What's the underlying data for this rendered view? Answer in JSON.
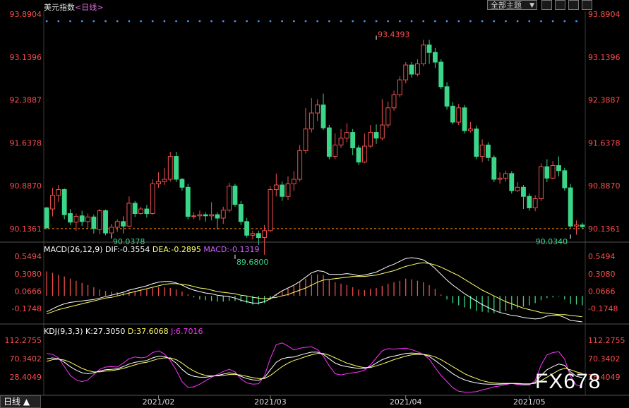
{
  "header": {
    "instrument": "美元指数",
    "timeframe": "<日线>",
    "theme_select": "全部主题"
  },
  "colors": {
    "up": "#f05050",
    "down": "#3cd68a",
    "axis_red": "#ff4d4d",
    "last_line": "#ff8c00",
    "dif": "#ffffff",
    "dea": "#ffff66",
    "macd_text": "#d060ff",
    "kdj_j": "#ff33ff",
    "dots": "#4a90ff"
  },
  "chart_data": [
    {
      "type": "candlestick",
      "ylim": [
        89.9,
        93.8904
      ],
      "axis_labels": [
        "93.8904",
        "93.1396",
        "92.3887",
        "91.6378",
        "90.8870",
        "90.1361"
      ],
      "axis_values": [
        93.8904,
        93.1396,
        92.3887,
        91.6378,
        90.887,
        90.1361
      ],
      "last_price": 90.1361,
      "x_ticks": [
        {
          "label": "2021/02",
          "index": 19
        },
        {
          "label": "2021/03",
          "index": 38
        },
        {
          "label": "2021/04",
          "index": 61
        },
        {
          "label": "2021/05",
          "index": 82
        }
      ],
      "annotations": [
        {
          "label": "93.4393",
          "index": 56,
          "value": 93.4393,
          "kind": "high"
        },
        {
          "label": "90.0378",
          "index": 11,
          "value": 90.0378,
          "kind": "low"
        },
        {
          "label": "89.6800",
          "index": 32,
          "value": 89.68,
          "kind": "low"
        },
        {
          "label": "90.0340",
          "index": 89,
          "value": 90.034,
          "kind": "low"
        }
      ],
      "candles": [
        [
          90.5,
          90.15,
          90.12,
          90.52
        ],
        [
          90.48,
          90.72,
          90.35,
          90.85
        ],
        [
          90.72,
          90.82,
          90.6,
          90.9
        ],
        [
          90.82,
          90.38,
          90.3,
          90.84
        ],
        [
          90.4,
          90.25,
          90.2,
          90.48
        ],
        [
          90.25,
          90.35,
          90.1,
          90.4
        ],
        [
          90.36,
          90.26,
          90.18,
          90.45
        ],
        [
          90.26,
          90.34,
          90.14,
          90.4
        ],
        [
          90.34,
          90.14,
          90.05,
          90.38
        ],
        [
          90.12,
          90.45,
          90.04,
          90.48
        ],
        [
          90.45,
          90.06,
          90.02,
          90.47
        ],
        [
          90.06,
          90.16,
          90.04,
          90.22
        ],
        [
          90.16,
          90.26,
          90.08,
          90.3
        ],
        [
          90.26,
          90.18,
          90.05,
          90.35
        ],
        [
          90.18,
          90.58,
          90.16,
          90.7
        ],
        [
          90.58,
          90.4,
          90.34,
          90.62
        ],
        [
          90.4,
          90.48,
          90.38,
          90.52
        ],
        [
          90.48,
          90.4,
          90.33,
          90.55
        ],
        [
          90.4,
          90.92,
          90.38,
          91.0
        ],
        [
          90.92,
          90.96,
          90.85,
          91.12
        ],
        [
          90.96,
          91.0,
          90.9,
          91.2
        ],
        [
          91.0,
          91.4,
          90.96,
          91.48
        ],
        [
          91.4,
          91.0,
          90.95,
          91.48
        ],
        [
          91.0,
          90.86,
          90.8,
          91.02
        ],
        [
          90.86,
          90.35,
          90.3,
          90.92
        ],
        [
          90.35,
          90.36,
          90.3,
          90.42
        ],
        [
          90.36,
          90.38,
          90.28,
          90.45
        ],
        [
          90.38,
          90.36,
          90.26,
          90.42
        ],
        [
          90.36,
          90.38,
          90.28,
          90.6
        ],
        [
          90.38,
          90.32,
          90.12,
          90.42
        ],
        [
          90.32,
          90.46,
          90.22,
          90.52
        ],
        [
          90.46,
          90.88,
          90.42,
          90.94
        ],
        [
          90.88,
          90.56,
          90.52,
          90.92
        ],
        [
          90.56,
          90.26,
          90.2,
          90.62
        ],
        [
          90.26,
          90.02,
          89.98,
          90.32
        ],
        [
          90.02,
          90.05,
          89.95,
          90.1
        ],
        [
          90.05,
          89.98,
          89.85,
          90.1
        ],
        [
          89.98,
          90.1,
          89.68,
          90.2
        ],
        [
          90.1,
          90.82,
          90.08,
          90.88
        ],
        [
          90.82,
          90.9,
          90.7,
          91.1
        ],
        [
          90.9,
          90.7,
          90.62,
          90.96
        ],
        [
          90.7,
          90.92,
          90.64,
          91.05
        ],
        [
          90.92,
          91.0,
          90.8,
          91.14
        ],
        [
          91.0,
          91.5,
          90.96,
          91.6
        ],
        [
          91.5,
          91.88,
          91.45,
          92.25
        ],
        [
          91.88,
          92.16,
          91.82,
          92.42
        ],
        [
          92.16,
          92.3,
          92.02,
          92.4
        ],
        [
          92.3,
          91.9,
          91.86,
          92.5
        ],
        [
          91.9,
          91.4,
          91.35,
          91.95
        ],
        [
          91.4,
          91.6,
          91.35,
          91.8
        ],
        [
          91.6,
          91.72,
          91.55,
          91.88
        ],
        [
          91.72,
          91.82,
          91.65,
          91.98
        ],
        [
          91.82,
          91.55,
          91.42,
          91.88
        ],
        [
          91.55,
          91.3,
          91.25,
          91.6
        ],
        [
          91.3,
          91.58,
          91.28,
          91.8
        ],
        [
          91.58,
          91.82,
          91.55,
          91.95
        ],
        [
          91.82,
          91.72,
          91.62,
          91.96
        ],
        [
          91.72,
          91.95,
          91.68,
          92.4
        ],
        [
          91.95,
          92.25,
          91.9,
          92.36
        ],
        [
          92.25,
          92.48,
          92.2,
          92.55
        ],
        [
          92.48,
          92.74,
          92.44,
          92.8
        ],
        [
          92.74,
          93.0,
          92.68,
          93.05
        ],
        [
          93.0,
          92.84,
          92.78,
          93.05
        ],
        [
          92.84,
          93.02,
          92.8,
          93.1
        ],
        [
          93.02,
          93.35,
          92.98,
          93.44
        ],
        [
          93.35,
          93.22,
          93.02,
          93.44
        ],
        [
          93.22,
          93.05,
          92.95,
          93.3
        ],
        [
          93.05,
          92.62,
          92.58,
          93.1
        ],
        [
          92.62,
          92.28,
          92.22,
          92.7
        ],
        [
          92.28,
          92.0,
          91.96,
          92.35
        ],
        [
          92.0,
          92.25,
          91.95,
          92.32
        ],
        [
          92.25,
          91.85,
          91.8,
          92.3
        ],
        [
          91.85,
          91.88,
          91.82,
          92.0
        ],
        [
          91.88,
          91.4,
          91.35,
          91.94
        ],
        [
          91.4,
          91.6,
          91.3,
          91.7
        ],
        [
          91.6,
          91.38,
          91.32,
          91.65
        ],
        [
          91.38,
          91.0,
          90.95,
          91.42
        ],
        [
          91.0,
          91.02,
          90.92,
          91.12
        ],
        [
          91.02,
          91.1,
          90.96,
          91.15
        ],
        [
          91.1,
          90.8,
          90.75,
          91.14
        ],
        [
          90.8,
          90.86,
          90.78,
          90.95
        ],
        [
          90.86,
          90.7,
          90.48,
          90.9
        ],
        [
          90.7,
          90.5,
          90.45,
          90.75
        ],
        [
          90.5,
          90.66,
          90.44,
          90.72
        ],
        [
          90.66,
          91.22,
          90.62,
          91.28
        ],
        [
          91.22,
          91.02,
          90.95,
          91.35
        ],
        [
          91.02,
          91.24,
          91.0,
          91.32
        ],
        [
          91.24,
          91.15,
          91.05,
          91.4
        ],
        [
          91.15,
          90.85,
          90.8,
          91.2
        ],
        [
          90.85,
          90.18,
          90.15,
          90.92
        ],
        [
          90.18,
          90.2,
          90.03,
          90.28
        ],
        [
          90.2,
          90.17,
          90.14,
          90.24
        ]
      ]
    },
    {
      "type": "bar",
      "name": "MACD",
      "header": "MACD(26,12,9)",
      "dif_label": "DIF:-0.3554",
      "dea_label": "DEA:-0.2895",
      "macd_label": "MACD:-0.1319",
      "axis_labels": [
        "0.5494",
        "0.3080",
        "0.0666",
        "-0.1748"
      ],
      "axis_values": [
        0.5494,
        0.308,
        0.0666,
        -0.1748
      ],
      "ylim": [
        -0.38,
        0.58
      ],
      "hist": [
        0.34,
        0.32,
        0.29,
        0.27,
        0.24,
        0.21,
        0.18,
        0.15,
        0.12,
        0.09,
        0.07,
        0.06,
        0.05,
        0.05,
        0.06,
        0.07,
        0.08,
        0.09,
        0.11,
        0.12,
        0.12,
        0.11,
        0.09,
        0.06,
        0.02,
        -0.02,
        -0.05,
        -0.06,
        -0.07,
        -0.08,
        -0.08,
        -0.07,
        -0.07,
        -0.08,
        -0.1,
        -0.12,
        -0.12,
        -0.1,
        -0.05,
        0.02,
        0.06,
        0.1,
        0.14,
        0.19,
        0.24,
        0.29,
        0.3,
        0.29,
        0.22,
        0.19,
        0.17,
        0.15,
        0.12,
        0.09,
        0.08,
        0.1,
        0.11,
        0.14,
        0.17,
        0.19,
        0.21,
        0.24,
        0.23,
        0.21,
        0.19,
        0.15,
        0.1,
        0.02,
        -0.05,
        -0.1,
        -0.13,
        -0.16,
        -0.18,
        -0.21,
        -0.22,
        -0.23,
        -0.24,
        -0.23,
        -0.21,
        -0.19,
        -0.17,
        -0.15,
        -0.13,
        -0.1,
        -0.06,
        -0.03,
        -0.02,
        -0.01,
        -0.05,
        -0.11,
        -0.12,
        -0.13
      ],
      "dif": [
        -0.22,
        -0.18,
        -0.14,
        -0.11,
        -0.09,
        -0.08,
        -0.07,
        -0.06,
        -0.05,
        -0.03,
        -0.01,
        0.01,
        0.03,
        0.05,
        0.08,
        0.1,
        0.12,
        0.14,
        0.17,
        0.19,
        0.2,
        0.2,
        0.18,
        0.15,
        0.11,
        0.08,
        0.06,
        0.04,
        0.03,
        0.01,
        0.0,
        -0.01,
        -0.03,
        -0.06,
        -0.08,
        -0.1,
        -0.1,
        -0.08,
        -0.04,
        0.02,
        0.07,
        0.11,
        0.15,
        0.2,
        0.26,
        0.32,
        0.35,
        0.34,
        0.3,
        0.3,
        0.3,
        0.31,
        0.3,
        0.28,
        0.29,
        0.31,
        0.33,
        0.37,
        0.41,
        0.44,
        0.48,
        0.52,
        0.53,
        0.52,
        0.5,
        0.45,
        0.38,
        0.3,
        0.22,
        0.15,
        0.09,
        0.03,
        -0.02,
        -0.07,
        -0.12,
        -0.16,
        -0.2,
        -0.23,
        -0.25,
        -0.27,
        -0.28,
        -0.3,
        -0.31,
        -0.32,
        -0.31,
        -0.28,
        -0.27,
        -0.27,
        -0.3,
        -0.34,
        -0.35,
        -0.36
      ],
      "dea": [
        -0.25,
        -0.22,
        -0.19,
        -0.17,
        -0.15,
        -0.13,
        -0.11,
        -0.09,
        -0.07,
        -0.05,
        -0.03,
        -0.02,
        0.0,
        0.02,
        0.04,
        0.06,
        0.08,
        0.1,
        0.12,
        0.14,
        0.16,
        0.17,
        0.17,
        0.16,
        0.15,
        0.13,
        0.11,
        0.1,
        0.08,
        0.06,
        0.05,
        0.04,
        0.03,
        0.01,
        0.0,
        -0.02,
        -0.03,
        -0.04,
        -0.03,
        -0.02,
        0.0,
        0.02,
        0.05,
        0.08,
        0.11,
        0.15,
        0.19,
        0.22,
        0.23,
        0.24,
        0.25,
        0.26,
        0.27,
        0.27,
        0.27,
        0.28,
        0.29,
        0.31,
        0.33,
        0.35,
        0.38,
        0.41,
        0.43,
        0.45,
        0.46,
        0.45,
        0.43,
        0.4,
        0.36,
        0.32,
        0.28,
        0.23,
        0.18,
        0.13,
        0.08,
        0.04,
        0.0,
        -0.04,
        -0.08,
        -0.11,
        -0.14,
        -0.17,
        -0.19,
        -0.21,
        -0.23,
        -0.24,
        -0.25,
        -0.26,
        -0.26,
        -0.27,
        -0.28,
        -0.29
      ]
    },
    {
      "type": "line",
      "name": "KDJ",
      "header": "KDJ(9,3,3)",
      "k_label": "K:27.3050",
      "d_label": "D:37.6068",
      "j_label": "J:6.7016",
      "axis_labels": [
        "112.2755",
        "70.3402",
        "28.4049"
      ],
      "axis_values": [
        112.2755,
        70.3402,
        28.4049
      ],
      "ylim": [
        -10,
        125
      ],
      "k": [
        70,
        72,
        70,
        62,
        52,
        44,
        38,
        36,
        38,
        42,
        45,
        46,
        47,
        52,
        58,
        62,
        64,
        66,
        72,
        76,
        75,
        70,
        60,
        46,
        35,
        30,
        28,
        28,
        30,
        32,
        35,
        38,
        36,
        30,
        25,
        22,
        21,
        27,
        45,
        62,
        70,
        73,
        74,
        78,
        82,
        85,
        85,
        80,
        70,
        60,
        55,
        52,
        50,
        48,
        48,
        52,
        60,
        68,
        73,
        76,
        79,
        82,
        83,
        82,
        80,
        75,
        66,
        56,
        46,
        36,
        28,
        22,
        18,
        15,
        13,
        12,
        12,
        12,
        13,
        14,
        13,
        12,
        12,
        16,
        32,
        45,
        52,
        58,
        55,
        40,
        30,
        27
      ],
      "d": [
        64,
        68,
        69,
        67,
        62,
        55,
        48,
        43,
        40,
        40,
        42,
        43,
        45,
        48,
        52,
        56,
        60,
        62,
        66,
        70,
        72,
        72,
        68,
        60,
        50,
        42,
        36,
        32,
        31,
        31,
        32,
        34,
        34,
        33,
        30,
        27,
        25,
        25,
        32,
        42,
        52,
        60,
        66,
        70,
        75,
        79,
        82,
        82,
        78,
        72,
        66,
        60,
        56,
        52,
        50,
        50,
        54,
        58,
        63,
        68,
        72,
        76,
        79,
        80,
        80,
        78,
        74,
        68,
        60,
        52,
        44,
        36,
        30,
        25,
        20,
        17,
        15,
        14,
        14,
        14,
        14,
        13,
        13,
        14,
        20,
        28,
        36,
        44,
        48,
        45,
        40,
        37
      ],
      "j": [
        82,
        80,
        72,
        52,
        32,
        22,
        18,
        22,
        34,
        46,
        51,
        52,
        51,
        60,
        70,
        74,
        72,
        74,
        84,
        88,
        81,
        66,
        44,
        18,
        5,
        6,
        12,
        20,
        28,
        34,
        41,
        46,
        40,
        24,
        15,
        12,
        13,
        31,
        71,
        102,
        106,
        99,
        90,
        94,
        96,
        97,
        91,
        76,
        54,
        36,
        33,
        36,
        38,
        40,
        44,
        56,
        72,
        88,
        93,
        92,
        93,
        94,
        91,
        86,
        80,
        69,
        50,
        32,
        18,
        4,
        -4,
        -6,
        -6,
        -5,
        -1,
        2,
        6,
        8,
        11,
        14,
        11,
        10,
        10,
        20,
        56,
        79,
        84,
        86,
        69,
        30,
        10,
        7
      ]
    }
  ],
  "watermark": "FX678",
  "timeframe_button": "日线 ▲"
}
